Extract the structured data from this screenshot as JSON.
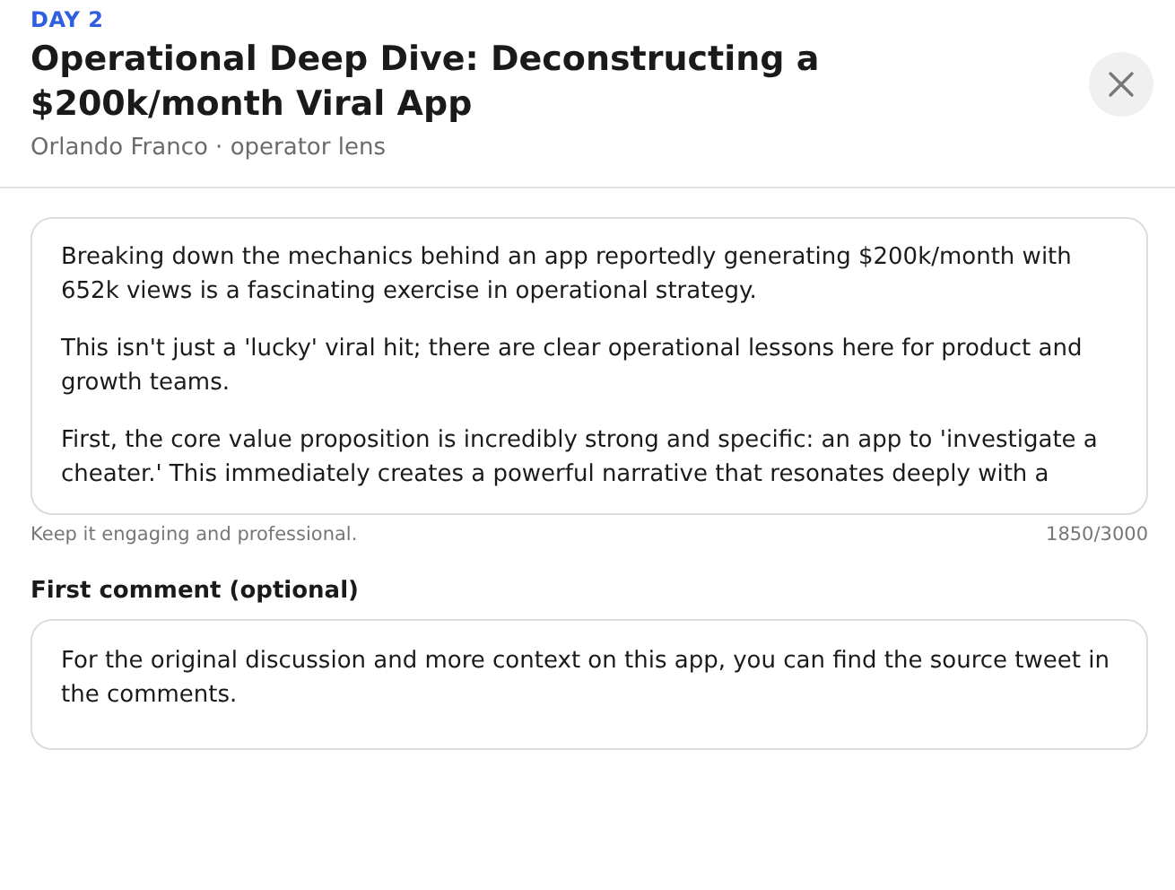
{
  "header": {
    "eyebrow": "DAY 2",
    "title": "Operational Deep Dive: Deconstructing a $200k/month Viral App",
    "byline": "Orlando Franco · operator lens"
  },
  "post": {
    "paragraphs": [
      "Breaking down the mechanics behind an app reportedly generating $200k/month with 652k views is a fascinating exercise in operational strategy.",
      "This isn't just a 'lucky' viral hit; there are clear operational lessons here for product and growth teams.",
      "First, the core value proposition is incredibly strong and specific: an app to 'investigate a cheater.' This immediately creates a powerful narrative that resonates deeply with a"
    ],
    "hint": "Keep it engaging and professional.",
    "counter": "1850/3000"
  },
  "comment": {
    "label": "First comment (optional)",
    "value": "For the original discussion and more context on this app, you can find the source tweet in the comments."
  }
}
